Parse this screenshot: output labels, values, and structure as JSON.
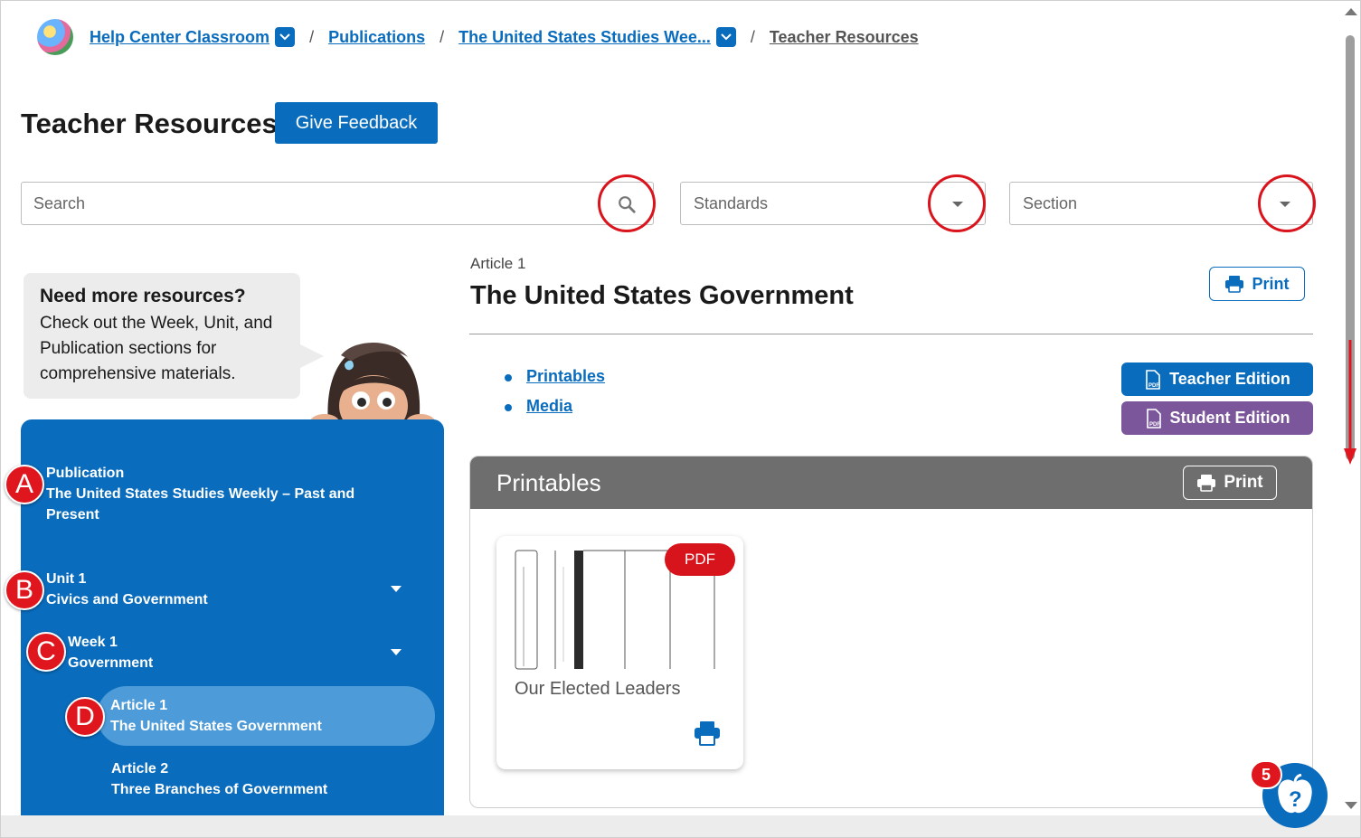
{
  "breadcrumb": {
    "items": [
      {
        "label": "Help Center Classroom",
        "has_dropdown": true
      },
      {
        "label": "Publications",
        "has_dropdown": false
      },
      {
        "label": "The United States Studies Wee...",
        "has_dropdown": true
      },
      {
        "label": "Teacher Resources",
        "has_dropdown": false
      }
    ],
    "separator": "/"
  },
  "header": {
    "title": "Teacher Resources",
    "feedback_label": "Give Feedback"
  },
  "filters": {
    "search_placeholder": "Search",
    "standards_label": "Standards",
    "section_label": "Section"
  },
  "bubble": {
    "title": "Need more resources?",
    "text": "Check out the Week, Unit, and Publication sections for comprehensive materials."
  },
  "nav": {
    "publication": {
      "kicker": "Publication",
      "title": "The United States Studies Weekly – Past and Present",
      "marker": "A"
    },
    "unit": {
      "kicker": "Unit 1",
      "title": "Civics and Government",
      "marker": "B"
    },
    "week": {
      "kicker": "Week 1",
      "title": "Government",
      "marker": "C"
    },
    "article1": {
      "kicker": "Article 1",
      "title": "The United States Government",
      "marker": "D"
    },
    "article2": {
      "kicker": "Article 2",
      "title": "Three Branches of Government"
    }
  },
  "article": {
    "kicker": "Article 1",
    "title": "The United States Government",
    "print_label": "Print",
    "links": [
      "Printables",
      "Media"
    ],
    "teacher_edition": "Teacher Edition",
    "student_edition": "Student Edition"
  },
  "printables": {
    "title": "Printables",
    "print_label": "Print",
    "cards": [
      {
        "title": "Our Elected Leaders",
        "badge": "PDF"
      }
    ]
  },
  "help_widget": {
    "count": "5"
  },
  "colors": {
    "brand_blue": "#0a6cbd",
    "student_purple": "#7b569b",
    "highlight_red": "#d9141c",
    "panel_gray": "#6e6e6e"
  }
}
